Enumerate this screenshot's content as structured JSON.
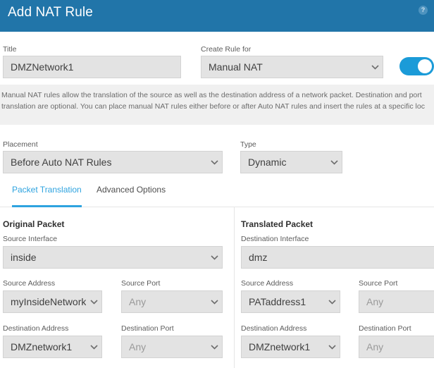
{
  "header": {
    "title": "Add NAT Rule",
    "help_icon": "help-circle-icon",
    "help_glyph": "?",
    "accent_color": "#2175a9"
  },
  "form": {
    "title_label": "Title",
    "title_value": "DMZNetwork1",
    "create_rule_for_label": "Create Rule for",
    "create_rule_for_value": "Manual NAT",
    "enable_toggle_state": "on",
    "toggle_color": "#1b9bd8"
  },
  "description": "Manual NAT rules allow the translation of the source as well as the destination address of a network packet. Destination and port\ntranslation are optional. You can place manual NAT rules either before or after Auto NAT rules and insert the rules at a specific loc",
  "placement": {
    "placement_label": "Placement",
    "placement_value": "Before Auto NAT Rules",
    "type_label": "Type",
    "type_value": "Dynamic"
  },
  "tabs": [
    {
      "label": "Packet Translation",
      "active": true
    },
    {
      "label": "Advanced Options",
      "active": false
    }
  ],
  "tab_accent_color": "#2ea3df",
  "original_packet": {
    "heading": "Original Packet",
    "source_interface_label": "Source Interface",
    "source_interface_value": "inside",
    "source_address_label": "Source Address",
    "source_address_value": "myInsideNetwork",
    "source_port_label": "Source Port",
    "source_port_value": "Any",
    "destination_address_label": "Destination Address",
    "destination_address_value": "DMZnetwork1",
    "destination_port_label": "Destination Port",
    "destination_port_value": "Any"
  },
  "translated_packet": {
    "heading": "Translated Packet",
    "destination_interface_label": "Destination Interface",
    "destination_interface_value": "dmz",
    "source_address_label": "Source Address",
    "source_address_value": "PATaddress1",
    "source_port_label": "Source Port",
    "source_port_value": "Any",
    "destination_address_label": "Destination Address",
    "destination_address_value": "DMZnetwork1",
    "destination_port_label": "Destination Port",
    "destination_port_value": "Any"
  }
}
